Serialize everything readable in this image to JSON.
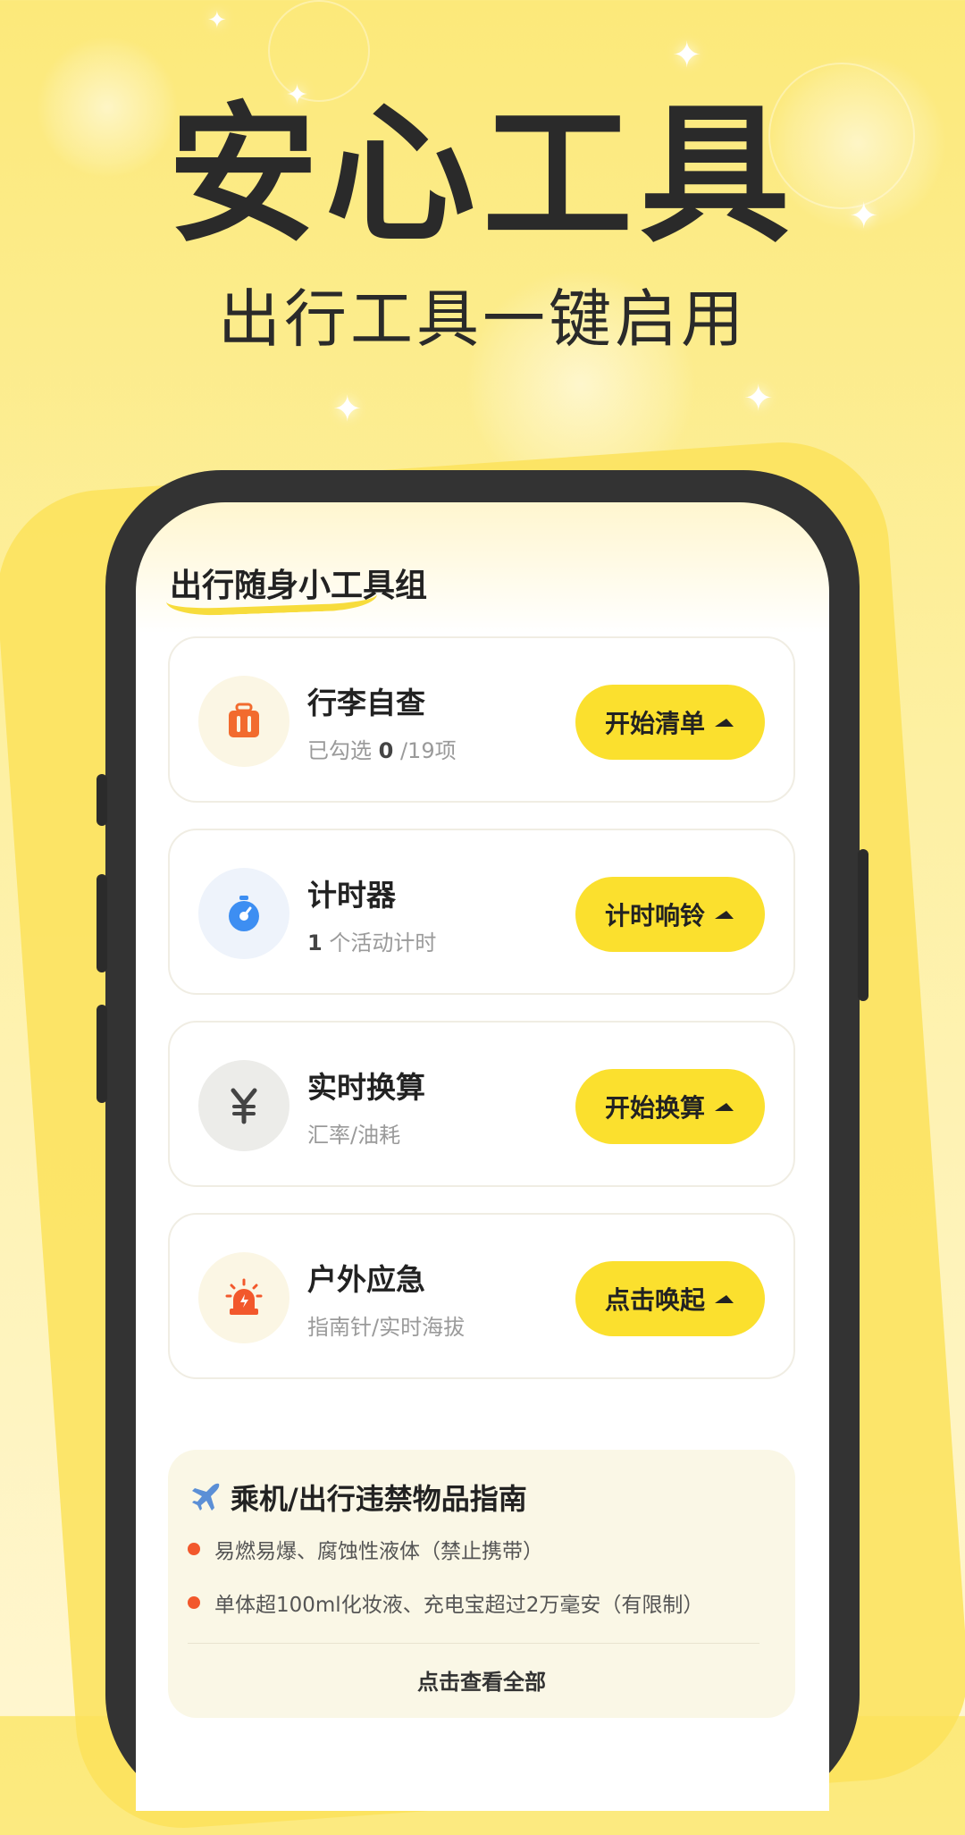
{
  "hero": {
    "title": "安心工具",
    "subtitle": "出行工具一键启用"
  },
  "screen": {
    "title": "出行随身小工具组"
  },
  "tools": [
    {
      "name": "行李自查",
      "desc_prefix": "已勾选 ",
      "desc_count": "0",
      "desc_suffix": " /19项",
      "button": "开始清单",
      "icon": "luggage-icon",
      "icon_bg": "#fbf6e4",
      "icon_color": "#f26b2e"
    },
    {
      "name": "计时器",
      "desc_prefix": "",
      "desc_count": "1",
      "desc_suffix": " 个活动计时",
      "button": "计时响铃",
      "icon": "stopwatch-icon",
      "icon_bg": "#eef3fb",
      "icon_color": "#3d8ef2"
    },
    {
      "name": "实时换算",
      "desc_prefix": "汇率/油耗",
      "desc_count": "",
      "desc_suffix": "",
      "button": "开始换算",
      "icon": "yen-icon",
      "icon_bg": "#ecece9",
      "icon_color": "#444444"
    },
    {
      "name": "户外应急",
      "desc_prefix": "指南针/实时海拔",
      "desc_count": "",
      "desc_suffix": "",
      "button": "点击唤起",
      "icon": "alarm-light-icon",
      "icon_bg": "#fbf6e4",
      "icon_color": "#f2582c"
    }
  ],
  "guide": {
    "icon": "airplane-icon",
    "title": "乘机/出行违禁物品指南",
    "items": [
      "易燃易爆、腐蚀性液体（禁止携带）",
      "单体超100ml化妆液、充电宝超过2万毫安（有限制）"
    ],
    "link": "点击查看全部"
  },
  "colors": {
    "accent": "#fbe02e",
    "background": "#fce97a",
    "bullet": "#f2582c"
  }
}
